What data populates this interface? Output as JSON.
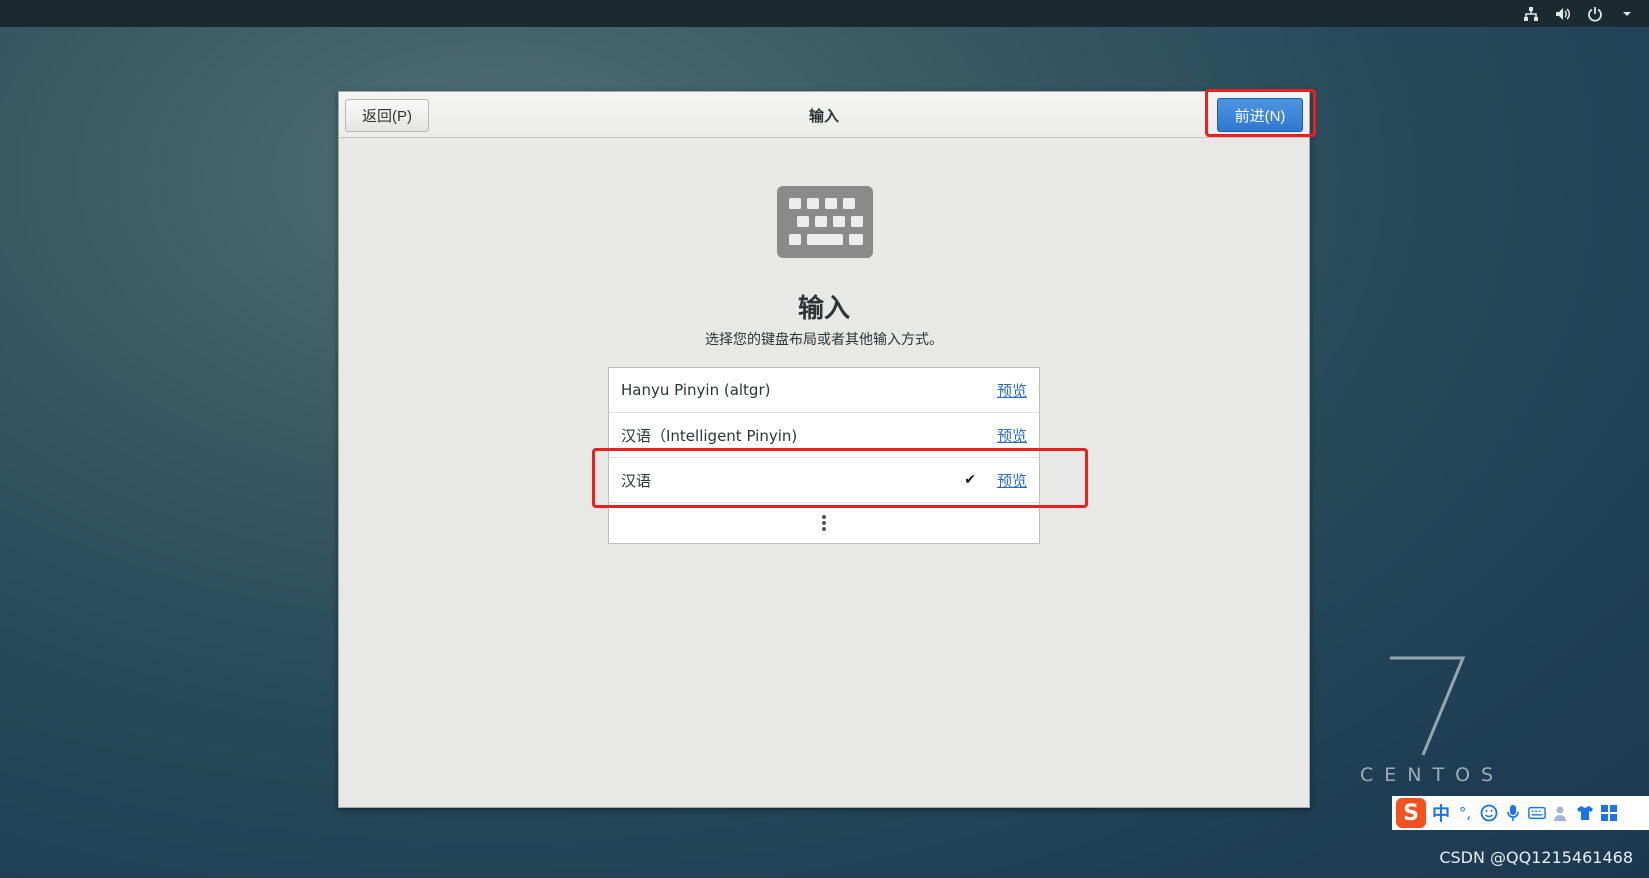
{
  "header": {
    "back_label": "返回(P)",
    "title": "输入",
    "next_label": "前进(N)"
  },
  "content": {
    "title": "输入",
    "subtitle": "选择您的键盘布局或者其他输入方式。",
    "preview_label": "预览",
    "items": [
      {
        "label": "Hanyu Pinyin (altgr)",
        "selected": false
      },
      {
        "label": "汉语（Intelligent Pinyin)",
        "selected": false
      },
      {
        "label": "汉语",
        "selected": true
      }
    ],
    "more_icon": "vertical-ellipsis-icon"
  },
  "watermark": {
    "version": "7",
    "brand": "CENTOS"
  },
  "ime_bar": {
    "mode_label": "中",
    "punct_label": "°,"
  },
  "credit": "CSDN @QQ1215461468",
  "colors": {
    "accent": "#2f78cf",
    "highlight": "#e8201e",
    "link": "#2a6bbf"
  }
}
